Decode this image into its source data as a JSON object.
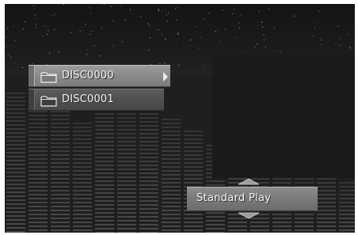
{
  "disc_list": {
    "items": [
      {
        "label": "DISC0000",
        "icon": "folder-icon",
        "selected": true
      },
      {
        "label": "DISC0001",
        "icon": "folder-icon",
        "selected": false
      }
    ]
  },
  "mode_selector": {
    "value": "Standard Play"
  },
  "colors": {
    "background": "#1f1f1f",
    "selected_item": "#8a8a8a",
    "item": "#505050",
    "text": "#f4f4f4"
  }
}
